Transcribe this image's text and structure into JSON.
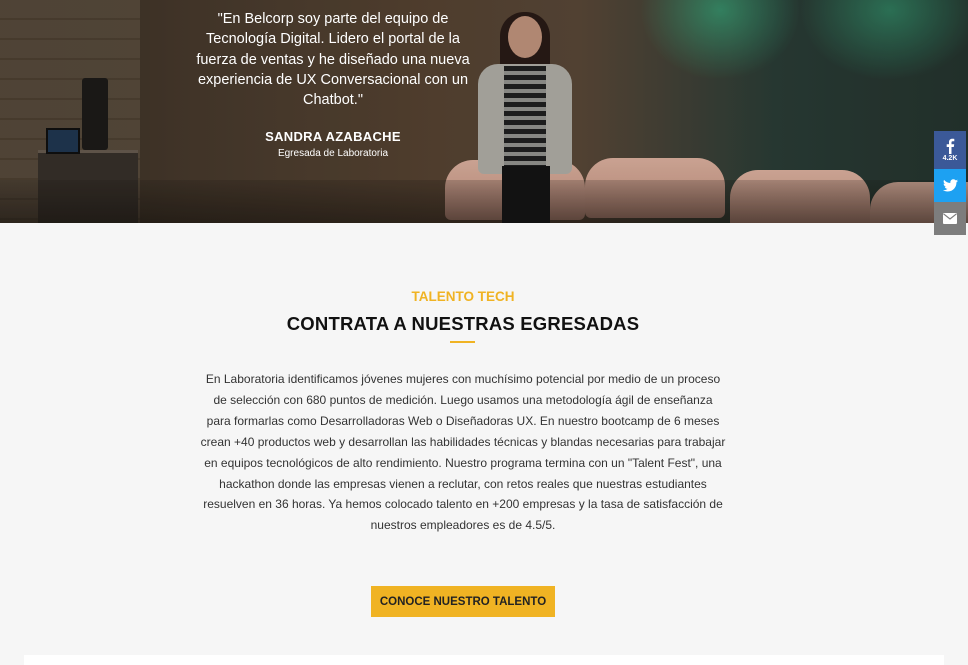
{
  "hero": {
    "quote": "\"En Belcorp soy parte del equipo de Tecnología Digital. Lidero el portal de la fuerza de ventas y he diseñado una nueva experiencia de UX Conversacional con un Chatbot.\"",
    "name": "SANDRA AZABACHE",
    "role": "Egresada de Laboratoria"
  },
  "share": {
    "facebook_icon": "facebook-icon",
    "facebook_count": "4.2K",
    "twitter_icon": "twitter-icon",
    "email_icon": "email-icon"
  },
  "section": {
    "kicker": "TALENTO TECH",
    "title": "CONTRATA A NUESTRAS EGRESADAS",
    "body": "En Laboratoria identificamos jóvenes mujeres con muchísimo potencial por medio de un proceso de selección con 680 puntos de medición. Luego usamos una metodología ágil de enseñanza para formarlas como Desarrolladoras Web o Diseñadoras UX. En nuestro bootcamp de 6 meses crean +40 productos web y desarrollan las habilidades técnicas y blandas necesarias para trabajar en equipos tecnológicos de alto rendimiento. Nuestro programa termina con un \"Talent Fest\", una hackathon donde las empresas vienen a reclutar, con retos reales que nuestras estudiantes resuelven en 36 horas. Ya hemos colocado talento en +200 empresas y la tasa de satisfacción de nuestros empleadores es de 4.5/5.",
    "cta_label": "CONOCE NUESTRO TALENTO"
  },
  "colors": {
    "accent": "#f0b323",
    "facebook": "#3b5998",
    "twitter": "#1da1f2",
    "email": "#7d7d7d"
  }
}
